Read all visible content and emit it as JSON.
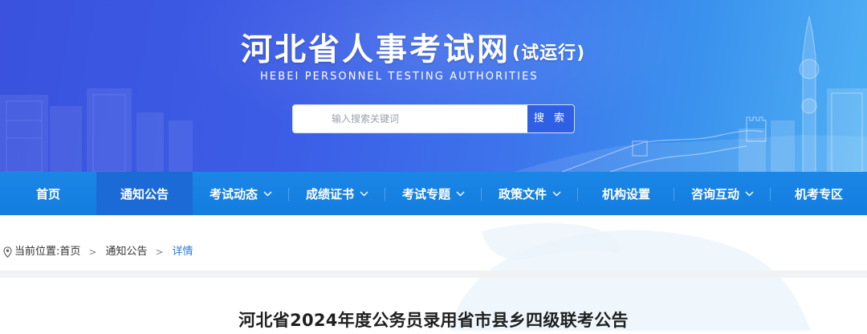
{
  "header": {
    "title": "河北省人事考试网",
    "title_suffix": "(试运行)",
    "subtitle": "HEBEI PERSONNEL TESTING AUTHORITIES",
    "search": {
      "placeholder": "输入搜索关键词",
      "button_label": "搜 索"
    }
  },
  "nav": {
    "items": [
      {
        "label": "首页",
        "dropdown": false,
        "active": false
      },
      {
        "label": "通知公告",
        "dropdown": false,
        "active": true
      },
      {
        "label": "考试动态",
        "dropdown": true,
        "active": false
      },
      {
        "label": "成绩证书",
        "dropdown": true,
        "active": false
      },
      {
        "label": "考试专题",
        "dropdown": true,
        "active": false
      },
      {
        "label": "政策文件",
        "dropdown": true,
        "active": false
      },
      {
        "label": "机构设置",
        "dropdown": false,
        "active": false
      },
      {
        "label": "咨询互动",
        "dropdown": true,
        "active": false
      },
      {
        "label": "机考专区",
        "dropdown": false,
        "active": false
      }
    ]
  },
  "breadcrumb": {
    "prefix": "当前位置:",
    "items": [
      "首页",
      "通知公告"
    ],
    "separator": ">",
    "current": "详情"
  },
  "article": {
    "title": "河北省2024年度公务员录用省市县乡四级联考公告"
  },
  "colors": {
    "banner_start": "#3a52de",
    "banner_end": "#4fb0f4",
    "nav_bg": "#1b86e6",
    "nav_active": "#1b6ad6",
    "search_button": "#2f5fe4",
    "breadcrumb_current": "#2a7ad5"
  },
  "icons": {
    "location": "map-pin-icon",
    "dropdown": "chevron-down-icon"
  }
}
